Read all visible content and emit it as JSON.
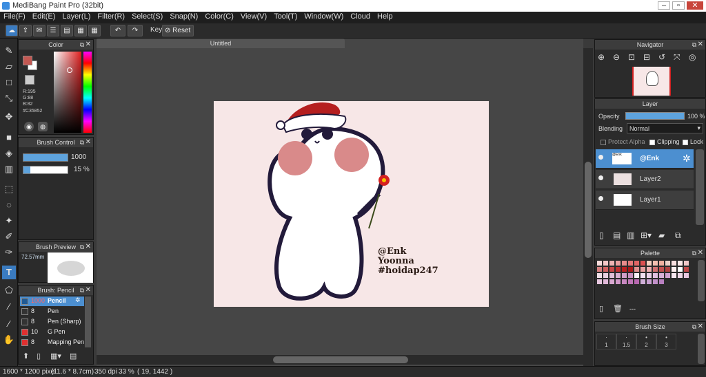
{
  "window": {
    "title": "MediBang Paint Pro (32bit)"
  },
  "menu": [
    "File(F)",
    "Edit(E)",
    "Layer(L)",
    "Filter(R)",
    "Select(S)",
    "Snap(N)",
    "Color(C)",
    "View(V)",
    "Tool(T)",
    "Window(W)",
    "Cloud",
    "Help"
  ],
  "toolbar": {
    "key_label": "Key",
    "reset_label": "Reset"
  },
  "color_panel": {
    "title": "Color",
    "r": "R:195",
    "g": "G:88",
    "b": "B:82",
    "hex": "#C35852",
    "primary": "#C35852"
  },
  "brush_control": {
    "title": "Brush Control",
    "size": "1000",
    "opacity": "15 %",
    "opacity_value": 0.15
  },
  "brush_preview": {
    "title": "Brush Preview",
    "size": "72.57mm"
  },
  "brush_list": {
    "title": "Brush: Pencil",
    "items": [
      {
        "size": "1000",
        "name": "Pencil",
        "color": "#4c8fd0",
        "selected": true
      },
      {
        "size": "8",
        "name": "Pen",
        "color": "#333333",
        "selected": false
      },
      {
        "size": "8",
        "name": "Pen (Sharp)",
        "color": "#333333",
        "selected": false
      },
      {
        "size": "10",
        "name": "G Pen",
        "color": "#e03030",
        "selected": false
      },
      {
        "size": "8",
        "name": "Mapping Pen",
        "color": "#e03030",
        "selected": false
      }
    ]
  },
  "document": {
    "tab": "Untitled",
    "sign_1": "@Enk",
    "sign_2": "Yoonna",
    "sign_3": "#hoidap247"
  },
  "navigator": {
    "title": "Navigator"
  },
  "layer_panel": {
    "title": "Layer",
    "opacity_label": "Opacity",
    "opacity_value": "100 %",
    "blending_label": "Blending",
    "blending_value": "Normal",
    "protect_alpha": "Protect Alpha",
    "clipping": "Clipping",
    "lock": "Lock",
    "layers": [
      {
        "name": "@Enk",
        "selected": true
      },
      {
        "name": "Layer2",
        "selected": false
      },
      {
        "name": "Layer1",
        "selected": false
      }
    ]
  },
  "palette": {
    "title": "Palette",
    "name": "---"
  },
  "brush_size": {
    "title": "Brush Size",
    "sizes": [
      "1",
      "1.5",
      "2",
      "3"
    ]
  },
  "status": {
    "dims": "1600 * 1200 pixel",
    "cm": "(11.6 * 8.7cm)",
    "dpi": "350 dpi",
    "zoom": "33 %",
    "coords": "( 19, 1442 )"
  }
}
